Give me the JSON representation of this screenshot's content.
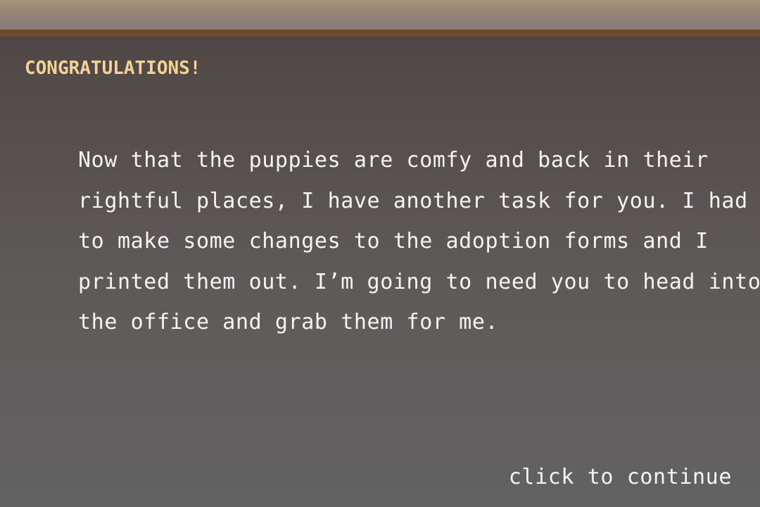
{
  "dialog": {
    "heading": "CONGRATULATIONS!",
    "message_lines": [
      "Now that the puppies are comfy and back in their",
      "rightful places, I have another task for you. I had",
      "to make some changes to the adoption forms and I",
      "printed them out. I’m going to need you to head into",
      "the office and grab them for me."
    ],
    "continue_label": "click to continue"
  },
  "colors": {
    "heading": "#f2d393",
    "text": "#f4f4f4",
    "border": "#6b4b2a"
  }
}
